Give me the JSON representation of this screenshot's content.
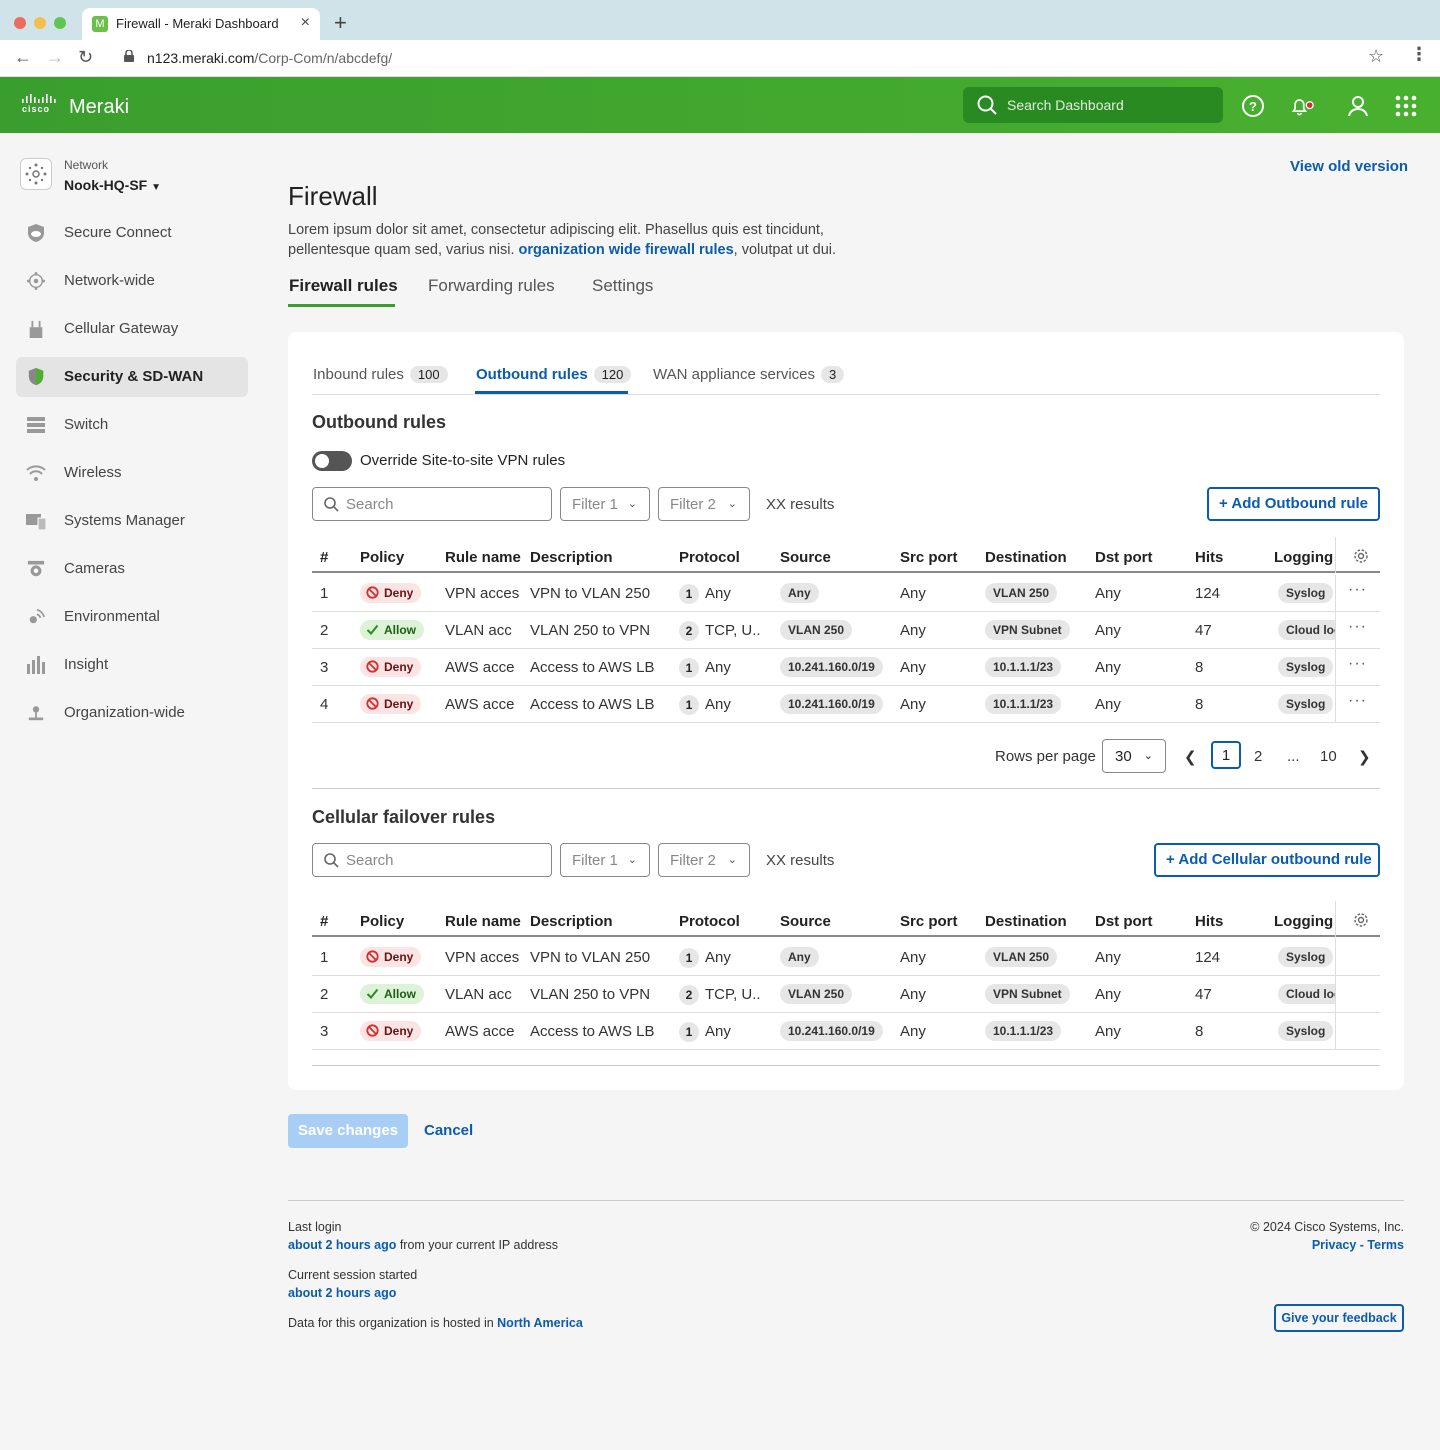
{
  "browser": {
    "tab_title": "Firewall - Meraki Dashboard",
    "tab_favicon": "M",
    "url_host": "n123.meraki.com",
    "url_path": "/Corp-Com/n/abcdefg/"
  },
  "header": {
    "logo_small": "cisco",
    "logo_name": "Meraki",
    "search_placeholder": "Search Dashboard",
    "brand_color": "#45a82f"
  },
  "sidebar": {
    "network_label": "Network",
    "network_value": "Nook-HQ-SF",
    "items": [
      {
        "label": "Secure Connect",
        "icon": "shield-cloud-icon"
      },
      {
        "label": "Network-wide",
        "icon": "network-icon"
      },
      {
        "label": "Cellular Gateway",
        "icon": "router-icon"
      },
      {
        "label": "Security & SD-WAN",
        "icon": "shield-icon",
        "active": true
      },
      {
        "label": "Switch",
        "icon": "switch-icon"
      },
      {
        "label": "Wireless",
        "icon": "wifi-icon"
      },
      {
        "label": "Systems Manager",
        "icon": "devices-icon"
      },
      {
        "label": "Cameras",
        "icon": "camera-icon"
      },
      {
        "label": "Environmental",
        "icon": "sensor-icon"
      },
      {
        "label": "Insight",
        "icon": "bar-chart-icon"
      },
      {
        "label": "Organization-wide",
        "icon": "org-icon"
      }
    ]
  },
  "page": {
    "view_old": "View old version",
    "title": "Firewall",
    "desc_before": "Lorem ipsum dolor sit amet, consectetur adipiscing elit. Phasellus quis est tincidunt, pellentesque quam sed, varius nisi. ",
    "desc_link": "organization wide firewall rules",
    "desc_after": ", volutpat ut dui.",
    "tabs": [
      "Firewall rules",
      "Forwarding rules",
      "Settings"
    ]
  },
  "subtabs": [
    {
      "label": "Inbound rules",
      "count": "100"
    },
    {
      "label": "Outbound rules",
      "count": "120",
      "active": true
    },
    {
      "label": "WAN appliance services",
      "count": "3"
    }
  ],
  "outbound": {
    "title": "Outbound rules",
    "toggle_label": "Override Site-to-site VPN rules",
    "search_placeholder": "Search",
    "filter1": "Filter 1",
    "filter2": "Filter 2",
    "results": "XX results",
    "add_label": "Add Outbound rule"
  },
  "columns": [
    "#",
    "Policy",
    "Rule name",
    "Description",
    "Protocol",
    "Source",
    "Src port",
    "Destination",
    "Dst port",
    "Hits",
    "Logging"
  ],
  "outbound_rows": [
    {
      "num": "1",
      "policy": "Deny",
      "name": "VPN acces",
      "desc": "VPN to VLAN 250",
      "proto_n": "1",
      "proto": "Any",
      "source": "Any",
      "src_port": "Any",
      "dest": "VLAN 250",
      "dst_port": "Any",
      "hits": "124",
      "logging": "Syslog"
    },
    {
      "num": "2",
      "policy": "Allow",
      "name": "VLAN acc",
      "desc": "VLAN 250 to VPN",
      "proto_n": "2",
      "proto": "TCP, U..",
      "source": "VLAN 250",
      "src_port": "Any",
      "dest": "VPN Subnet",
      "dst_port": "Any",
      "hits": "47",
      "logging": "Cloud log"
    },
    {
      "num": "3",
      "policy": "Deny",
      "name": "AWS acce",
      "desc": "Access to AWS LB",
      "proto_n": "1",
      "proto": "Any",
      "source": "10.241.160.0/19",
      "src_port": "Any",
      "dest": "10.1.1.1/23",
      "dst_port": "Any",
      "hits": "8",
      "logging": "Syslog"
    },
    {
      "num": "4",
      "policy": "Deny",
      "name": "AWS acce",
      "desc": "Access to AWS LB",
      "proto_n": "1",
      "proto": "Any",
      "source": "10.241.160.0/19",
      "src_port": "Any",
      "dest": "10.1.1.1/23",
      "dst_port": "Any",
      "hits": "8",
      "logging": "Syslog"
    }
  ],
  "pager": {
    "label": "Rows per page",
    "rows": "30",
    "pages": [
      "1",
      "2",
      "...",
      "10"
    ]
  },
  "cellular": {
    "title": "Cellular failover rules",
    "search_placeholder": "Search",
    "filter1": "Filter 1",
    "filter2": "Filter 2",
    "results": "XX results",
    "add_label": "Add Cellular outbound rule"
  },
  "cellular_rows": [
    {
      "num": "1",
      "policy": "Deny",
      "name": "VPN acces",
      "desc": "VPN to VLAN 250",
      "proto_n": "1",
      "proto": "Any",
      "source": "Any",
      "src_port": "Any",
      "dest": "VLAN 250",
      "dst_port": "Any",
      "hits": "124",
      "logging": "Syslog"
    },
    {
      "num": "2",
      "policy": "Allow",
      "name": "VLAN acc",
      "desc": "VLAN 250 to VPN",
      "proto_n": "2",
      "proto": "TCP, U..",
      "source": "VLAN 250",
      "src_port": "Any",
      "dest": "VPN Subnet",
      "dst_port": "Any",
      "hits": "47",
      "logging": "Cloud log"
    },
    {
      "num": "3",
      "policy": "Deny",
      "name": "AWS acce",
      "desc": "Access to AWS LB",
      "proto_n": "1",
      "proto": "Any",
      "source": "10.241.160.0/19",
      "src_port": "Any",
      "dest": "10.1.1.1/23",
      "dst_port": "Any",
      "hits": "8",
      "logging": "Syslog"
    }
  ],
  "actions": {
    "save": "Save changes",
    "cancel": "Cancel"
  },
  "footer": {
    "last_login_label": "Last login",
    "last_login_value": "about 2 hours ago",
    "last_login_suffix": " from your current IP address",
    "session_label": "Current session started",
    "session_value": "about 2 hours ago",
    "hosted_prefix": "Data for this organization is hosted in ",
    "hosted_region": "North America",
    "copyright": "© 2024 Cisco Systems, Inc.",
    "privacy": "Privacy",
    "sep": " - ",
    "terms": "Terms",
    "feedback": "Give your feedback"
  }
}
